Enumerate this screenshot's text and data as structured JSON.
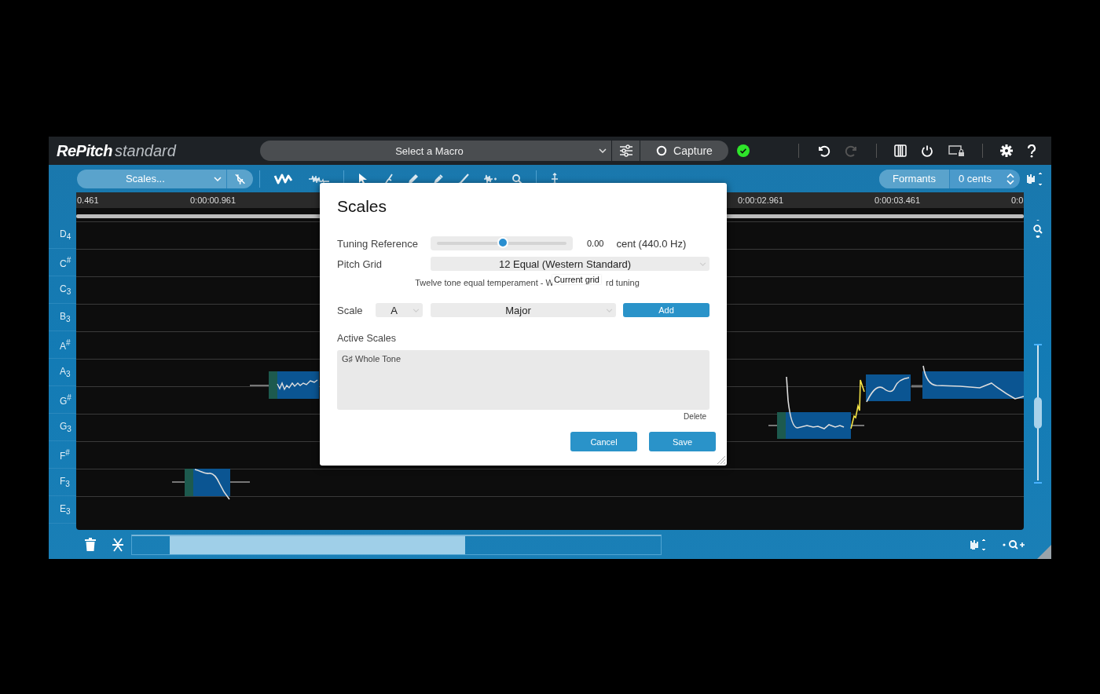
{
  "app": {
    "logo_bold": "RePitch",
    "logo_light": "standard"
  },
  "macro": {
    "placeholder": "Select a Macro"
  },
  "capture": {
    "label": "Capture"
  },
  "history_buttons": [
    {
      "kind": "undo",
      "disabled": false
    },
    {
      "kind": "redo",
      "disabled": true
    }
  ],
  "scales_dropdown": {
    "value": "Scales..."
  },
  "formants": {
    "label": "Formants",
    "value": "0 cents"
  },
  "vertical_zoom": {
    "level": 0.5
  },
  "ruler": [
    "0.461",
    "0:00:00.961",
    "0:00:02.961",
    "0:00:03.461",
    "0:0"
  ],
  "keys": [
    "D$_{4}$",
    "C$^{#}$",
    "C$_{3}$",
    "B$_{3}$",
    "A$^{#}$",
    "A$_{3}$",
    "G$^{#}$",
    "G$_{3}$",
    "F$^{#}$",
    "F$_{3}$",
    "E$_{3}$"
  ],
  "dialog": {
    "title": "Scales",
    "tuning": {
      "label": "Tuning Reference",
      "level": 0.5,
      "value": "0.00",
      "unit": "cent (440.0 Hz)"
    },
    "pitch_grid": {
      "label": "Pitch Grid",
      "value": "12 Equal (Western Standard)",
      "description_start": "Twelve tone equal temperament - W",
      "description_end": "rd tuning",
      "tooltip": "Current grid"
    },
    "scale": {
      "label": "Scale",
      "root": "A",
      "type": "Major",
      "add": "Add"
    },
    "active_scales": {
      "label": "Active Scales",
      "items": [
        {
          "name": "G♯ Whole Tone",
          "selected": false
        }
      ],
      "delete": "Delete"
    },
    "buttons": [
      "Cancel",
      "Save"
    ]
  }
}
